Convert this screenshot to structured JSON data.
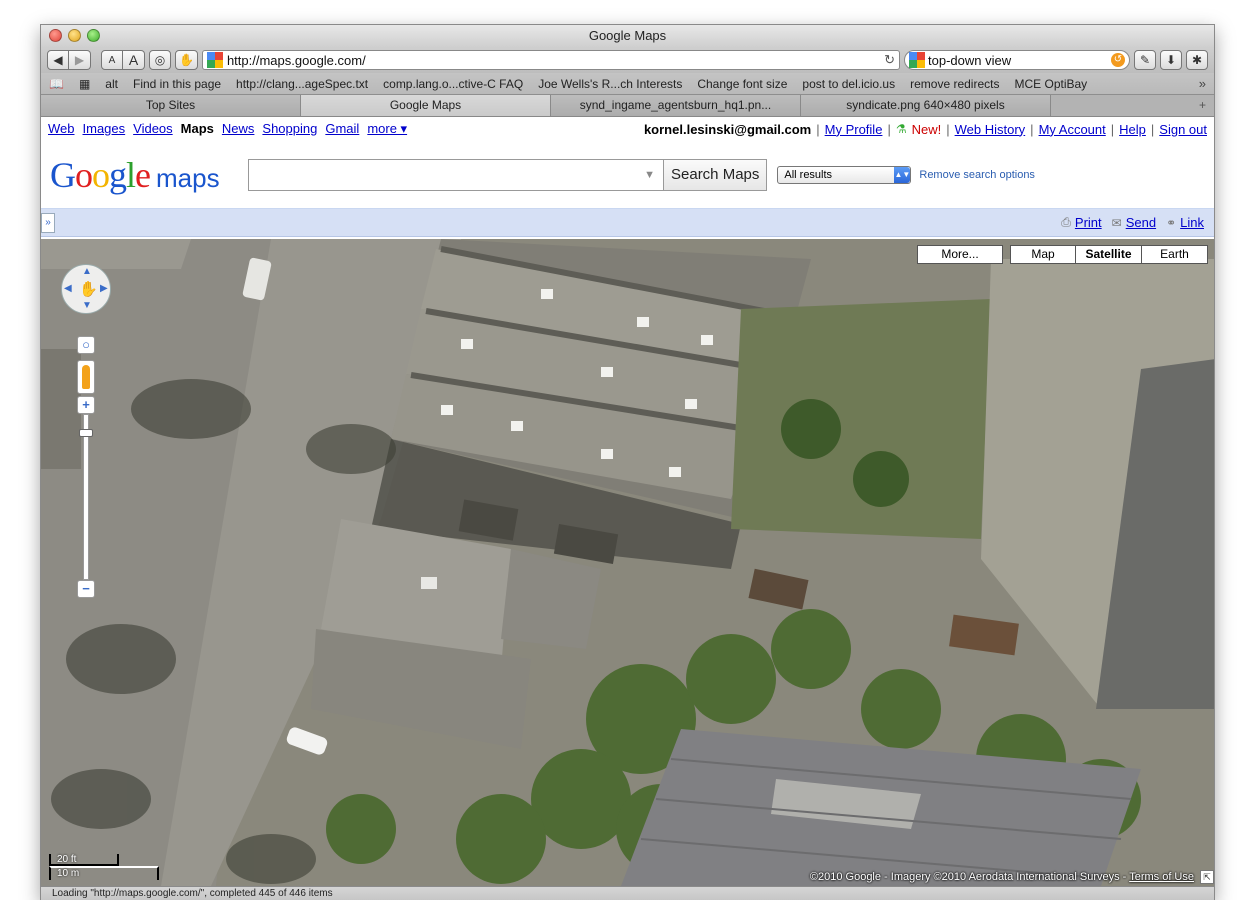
{
  "window": {
    "title": "Google Maps"
  },
  "toolbar": {
    "back": "◀",
    "forward": "▶",
    "font_smaller": "A",
    "font_larger": "A",
    "url": "http://maps.google.com/",
    "reload": "↻",
    "search_value": "top-down view"
  },
  "bookmarks": [
    "alt",
    "Find in this page",
    "http://clang...ageSpec.txt",
    "comp.lang.o...ctive-C FAQ",
    "Joe Wells's R...ch Interests",
    "Change font size",
    "post to del.icio.us",
    "remove redirects",
    "MCE OptiBay"
  ],
  "bookmarks_more": "»",
  "tabs": [
    {
      "label": "Top Sites"
    },
    {
      "label": "Google Maps"
    },
    {
      "label": "synd_ingame_agentsburn_hq1.pn..."
    },
    {
      "label": "syndicate.png 640×480 pixels"
    }
  ],
  "tab_add": "+",
  "gbar": {
    "links": [
      "Web",
      "Images",
      "Videos",
      "Maps",
      "News",
      "Shopping",
      "Gmail",
      "more ▾"
    ],
    "current": "Maps",
    "email": "kornel.lesinski@gmail.com",
    "my_profile": "My Profile",
    "new": "New!",
    "web_history": "Web History",
    "my_account": "My Account",
    "help": "Help",
    "sign_out": "Sign out",
    "separator": "|"
  },
  "header": {
    "logo_letters": [
      "G",
      "o",
      "o",
      "g",
      "l",
      "e"
    ],
    "logo_suffix": "maps",
    "search_placeholder": "",
    "search_button": "Search Maps",
    "filter_value": "All results",
    "remove_options": "Remove search options"
  },
  "printbar": {
    "collapse": "»",
    "print": "Print",
    "send": "Send",
    "link": "Link"
  },
  "map": {
    "more": "More...",
    "types": [
      "Map",
      "Satellite",
      "Earth"
    ],
    "selected_type": "Satellite",
    "zoom_in": "+",
    "zoom_out": "−",
    "scale_top": "20 ft",
    "scale_bottom": "10 m",
    "copyright": "©2010 Google - Imagery ©2010 Aerodata International Surveys - ",
    "terms": "Terms of Use"
  },
  "status": {
    "text": "Loading \"http://maps.google.com/\", completed 445 of 446 items"
  },
  "colors": {
    "link": "#0000cc",
    "google_blue": "#1a55cd",
    "google_red": "#e01f1f",
    "google_yellow": "#f3b400",
    "google_green": "#2da02d",
    "printbar_bg": "#d6e0f5"
  }
}
